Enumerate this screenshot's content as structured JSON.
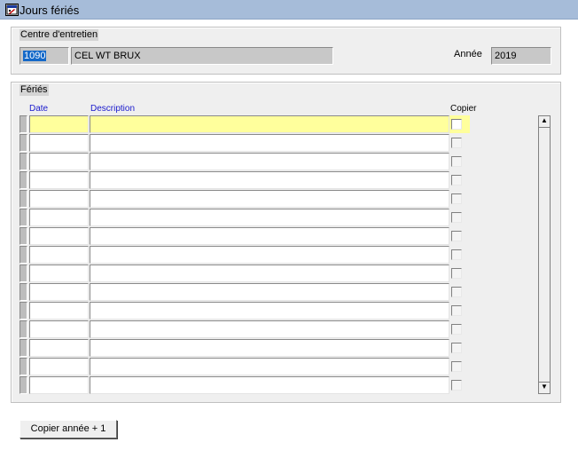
{
  "window": {
    "title": "Jours fériés",
    "icon": "application-window-icon"
  },
  "centre": {
    "group_label": "Centre d'entretien",
    "code": "1090",
    "name": "CEL WT BRUX",
    "year_label": "Année",
    "year": "2019"
  },
  "feries": {
    "group_label": "Fériés",
    "columns": {
      "date": "Date",
      "description": "Description",
      "copier": "Copier"
    },
    "rows": [
      {
        "date": "",
        "description": "",
        "copier": false
      },
      {
        "date": "",
        "description": "",
        "copier": false
      },
      {
        "date": "",
        "description": "",
        "copier": false
      },
      {
        "date": "",
        "description": "",
        "copier": false
      },
      {
        "date": "",
        "description": "",
        "copier": false
      },
      {
        "date": "",
        "description": "",
        "copier": false
      },
      {
        "date": "",
        "description": "",
        "copier": false
      },
      {
        "date": "",
        "description": "",
        "copier": false
      },
      {
        "date": "",
        "description": "",
        "copier": false
      },
      {
        "date": "",
        "description": "",
        "copier": false
      },
      {
        "date": "",
        "description": "",
        "copier": false
      },
      {
        "date": "",
        "description": "",
        "copier": false
      },
      {
        "date": "",
        "description": "",
        "copier": false
      },
      {
        "date": "",
        "description": "",
        "copier": false
      },
      {
        "date": "",
        "description": "",
        "copier": false
      }
    ],
    "scroll_up_glyph": "▲",
    "scroll_down_glyph": "▼"
  },
  "actions": {
    "copy_year_label": "Copier année + 1"
  },
  "colors": {
    "active_row": "#ffff9c",
    "title_bar": "#a6bcd9",
    "column_header": "#1a1acc",
    "selection": "#1468c8"
  }
}
